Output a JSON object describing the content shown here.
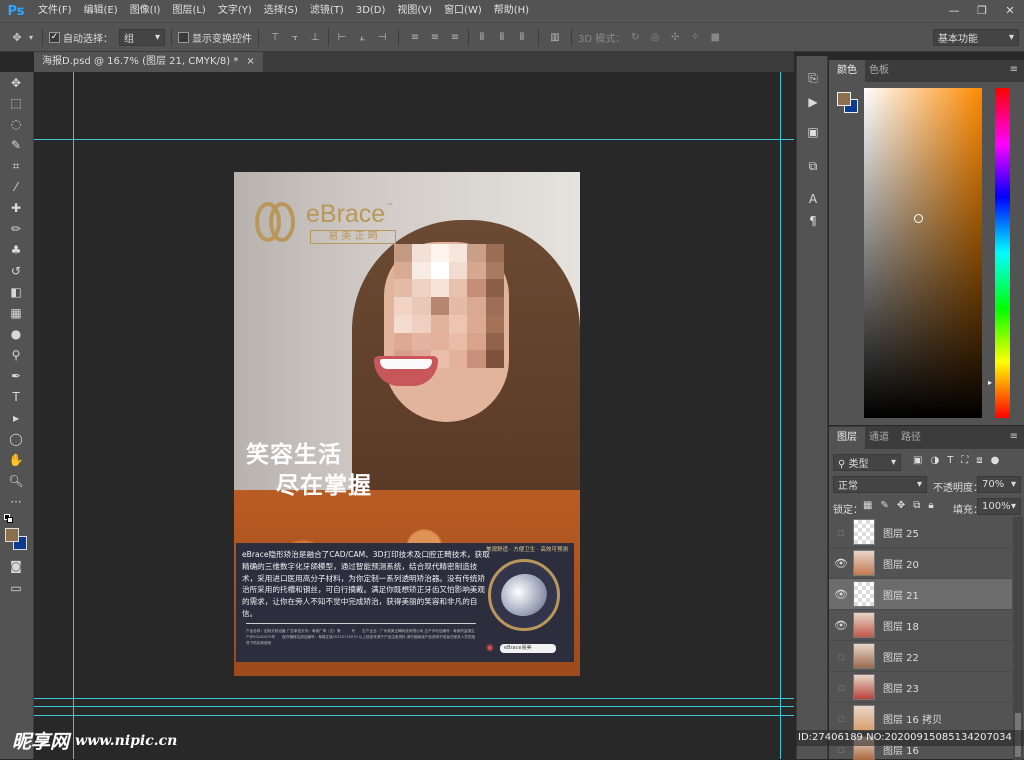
{
  "app": {
    "logo": "Ps"
  },
  "menu": [
    "文件(F)",
    "编辑(E)",
    "图像(I)",
    "图层(L)",
    "文字(Y)",
    "选择(S)",
    "滤镜(T)",
    "3D(D)",
    "视图(V)",
    "窗口(W)",
    "帮助(H)"
  ],
  "window_buttons": [
    "—",
    "❐",
    "✕"
  ],
  "options": {
    "auto_select_label": "自动选择：",
    "auto_select_value": "组",
    "show_transform_label": "显示变换控件",
    "mode_3d_label": "3D 模式：",
    "workspace": "基本功能"
  },
  "document": {
    "tab_title": "海报D.psd @ 16.7% (图层 21, CMYK/8) *",
    "close": "×"
  },
  "poster": {
    "brand_name": "eBrace",
    "brand_tm": "™",
    "brand_cn": "易 美 正 畸",
    "headline_1": "笑容生活",
    "headline_2": "尽在掌握",
    "body": "eBrace隐形矫治是融合了CAD/CAM、3D打印技术及口腔正畸技术，获取精确的三维数字化牙颌模型，通过智能预测系统，结合现代精密制造技术，采用进口医用高分子材料，为你定制一系列透明矫治器。没有传统矫治所采用的托槽和钢丝，可自行摘戴。满足你既想矫正牙齿又怕影响美观的需求，让你在旁人不知不觉中完成矫治，获得美丽的笑容和非凡的自信。",
    "fine_print": "产品名称：定制式矫治器 广告审查文号：粤械广审（文）第　　　号　　生产企业：广州易美正畸科技有限公司 生产许可证编号：粤食药监械生产许20140075号　　医疗器械注册证编号：粤械注准20152170070 以上信息来源于产品注册资料 请仔细阅读产品说明书或者在医务人员的指导下购买和使用",
    "seal_text": "美观舒适 · 方便卫生 · 高效可预测",
    "search_text": "eBrace易美"
  },
  "color_panel": {
    "tabs": [
      "颜色",
      "色板"
    ],
    "foreground": "#8c6f4c",
    "background": "#0b3a8f"
  },
  "layers_panel": {
    "tabs": [
      "图层",
      "通道",
      "路径"
    ],
    "filter": "类型",
    "blend_mode": "正常",
    "opacity_label": "不透明度：",
    "opacity_value": "70%",
    "lock_label": "锁定：",
    "fill_label": "填充：",
    "fill_value": "100%",
    "layers": [
      {
        "name": "图层 25",
        "visible": false,
        "selected": false
      },
      {
        "name": "图层 20",
        "visible": true,
        "selected": false
      },
      {
        "name": "图层 21",
        "visible": true,
        "selected": true
      },
      {
        "name": "图层 18",
        "visible": true,
        "selected": false
      },
      {
        "name": "图层 22",
        "visible": false,
        "selected": false
      },
      {
        "name": "图层 23",
        "visible": false,
        "selected": false
      },
      {
        "name": "图层 16 拷贝",
        "visible": false,
        "selected": false
      },
      {
        "name": "图层 16",
        "visible": false,
        "selected": false
      }
    ]
  },
  "watermark": {
    "site_cn": "昵享网",
    "site_url": "www.nipic.cn",
    "id_text": "ID:27406189 NO:20200915085134207034"
  }
}
